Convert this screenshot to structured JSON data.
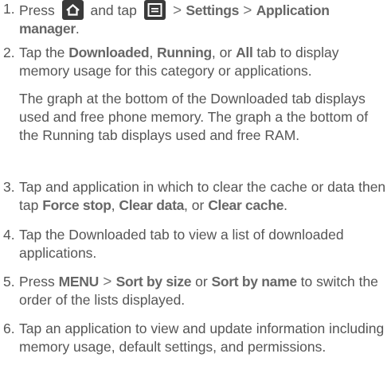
{
  "steps": [
    {
      "number": "1.",
      "parts": [
        {
          "text": "Press ",
          "style": "plain"
        },
        {
          "icon": "home-icon"
        },
        {
          "text": " and tap ",
          "style": "plain"
        },
        {
          "icon": "menu-icon"
        },
        {
          "text": " > ",
          "style": "gt"
        },
        {
          "text": "Settings",
          "style": "bold"
        },
        {
          "text": " > ",
          "style": "gt"
        },
        {
          "text": "Application manager",
          "style": "bold"
        },
        {
          "text": ".",
          "style": "plain"
        }
      ]
    },
    {
      "number": "2.",
      "parts": [
        {
          "text": "Tap the ",
          "style": "plain"
        },
        {
          "text": "Downloaded",
          "style": "bold"
        },
        {
          "text": ", ",
          "style": "plain"
        },
        {
          "text": "Running",
          "style": "bold"
        },
        {
          "text": ", or ",
          "style": "plain"
        },
        {
          "text": "All",
          "style": "bold"
        },
        {
          "text": " tab to display memory usage for this category or applications.",
          "style": "plain"
        }
      ],
      "note": "The graph at the bottom of the Downloaded tab displays used and free phone memory. The graph a the bottom of the Running tab displays used and free RAM."
    },
    {
      "number": "3.",
      "parts": [
        {
          "text": "Tap and application in which to clear the cache or data then tap ",
          "style": "plain"
        },
        {
          "text": "Force stop",
          "style": "bold"
        },
        {
          "text": ", ",
          "style": "plain"
        },
        {
          "text": "Clear data",
          "style": "bold"
        },
        {
          "text": ", or ",
          "style": "plain"
        },
        {
          "text": "Clear cache",
          "style": "bold"
        },
        {
          "text": ".",
          "style": "plain"
        }
      ]
    },
    {
      "number": "4.",
      "parts": [
        {
          "text": "Tap the Downloaded tab to view a list of downloaded applications.",
          "style": "plain"
        }
      ]
    },
    {
      "number": "5.",
      "parts": [
        {
          "text": "Press ",
          "style": "plain"
        },
        {
          "text": "MENU",
          "style": "bold"
        },
        {
          "text": " > ",
          "style": "gt"
        },
        {
          "text": "Sort by size",
          "style": "bold"
        },
        {
          "text": " or ",
          "style": "plain"
        },
        {
          "text": "Sort by name",
          "style": "bold"
        },
        {
          "text": " to switch the order of the lists displayed.",
          "style": "plain"
        }
      ]
    },
    {
      "number": "6.",
      "parts": [
        {
          "text": "Tap an application to view and update information including memory usage, default settings, and permissions.",
          "style": "plain"
        }
      ]
    }
  ]
}
